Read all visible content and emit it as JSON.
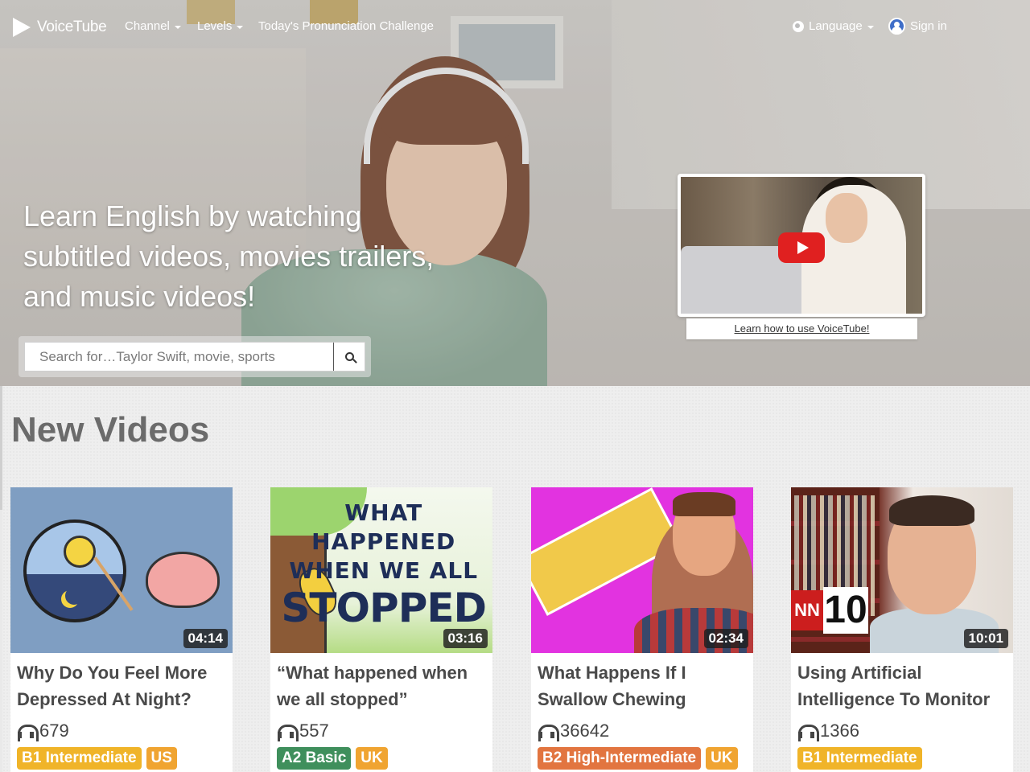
{
  "nav": {
    "logo_text": "VoiceTube",
    "channel_label": "Channel",
    "levels_label": "Levels",
    "challenge_label": "Today's Pronunciation Challenge",
    "language_label": "Language",
    "signin_label": "Sign in"
  },
  "hero": {
    "tagline": "Learn English by watching subtitled videos, movies trailers, and music videos!",
    "search_placeholder": "Search for…Taylor Swift, movie, sports",
    "tutorial_link": "Learn how to use VoiceTube!"
  },
  "section": {
    "title": "New Videos"
  },
  "videos": [
    {
      "title": "Why Do You Feel More Depressed At Night?",
      "duration": "04:14",
      "views": "679",
      "level": "B1 Intermediate",
      "accent": "US"
    },
    {
      "title": "“What happened when we all stopped”",
      "duration": "03:16",
      "views": "557",
      "level": "A2 Basic",
      "accent": "UK",
      "thumb_text_line1": "WHAT",
      "thumb_text_line2": "HAPPENED",
      "thumb_text_line3": "WHEN WE ALL",
      "thumb_text_line4": "STOPPED"
    },
    {
      "title": "What Happens If I Swallow Chewing",
      "duration": "02:34",
      "views": "36642",
      "level": "B2 High-Intermediate",
      "accent": "UK"
    },
    {
      "title": "Using Artificial Intelligence To Monitor",
      "duration": "10:01",
      "views": "1366",
      "level": "B1 Intermediate",
      "thumb_logo": "NN",
      "thumb_number": "10"
    }
  ],
  "colors": {
    "level_b1": "#f0b429",
    "level_a2": "#3f8f5c",
    "level_b2": "#e27540",
    "accent_tag": "#f0a431",
    "section_title": "#6b6b6b",
    "play_button": "#e02020"
  }
}
